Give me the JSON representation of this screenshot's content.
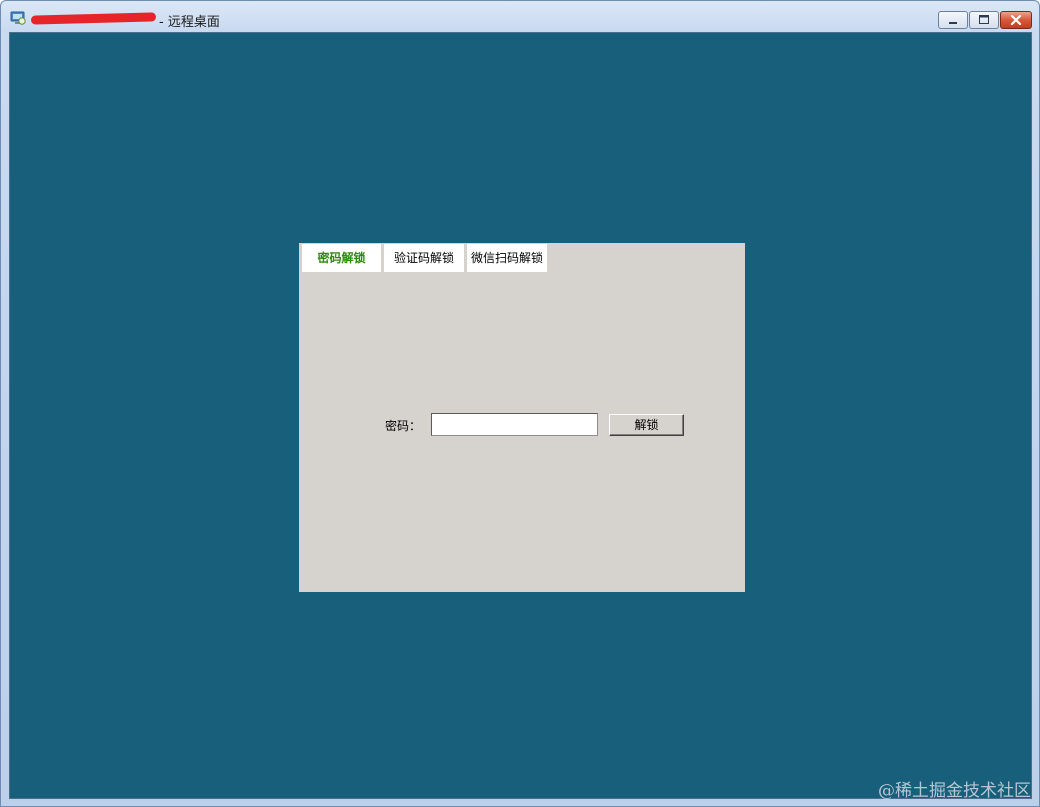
{
  "window": {
    "title": "- 远程桌面",
    "icon": "remote-desktop-icon",
    "controls": {
      "minimize": "minimize-icon",
      "maximize": "maximize-icon",
      "close": "close-icon"
    }
  },
  "colors": {
    "desktop": "#185f7b",
    "panel": "#d6d3ce",
    "active_tab_text": "#2e8b0f",
    "close_button": "#d8593b"
  },
  "unlock_panel": {
    "tabs": [
      {
        "label": "密码解锁",
        "active": true
      },
      {
        "label": "验证码解锁",
        "active": false
      },
      {
        "label": "微信扫码解锁",
        "active": false
      }
    ],
    "password_label": "密码：",
    "password_value": "",
    "unlock_button": "解锁"
  },
  "watermark": "@稀土掘金技术社区"
}
